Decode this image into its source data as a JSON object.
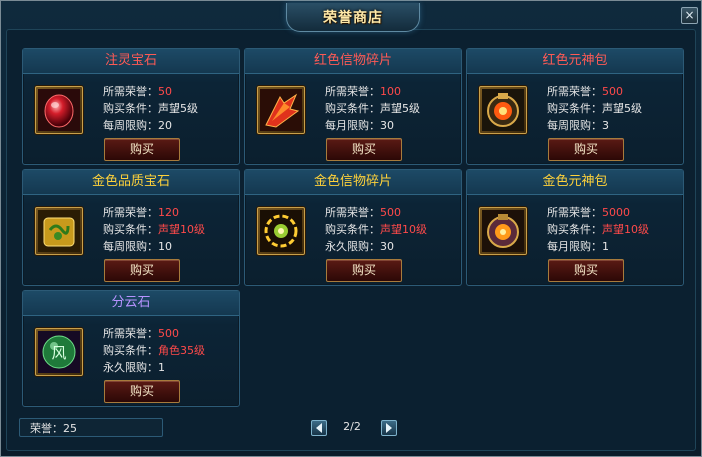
{
  "window": {
    "title": "荣誉商店",
    "close_label": "×"
  },
  "labels": {
    "cost": "所需荣誉：",
    "condition": "购买条件：",
    "buy": "购买"
  },
  "items": [
    {
      "name": "注灵宝石",
      "name_color": "red",
      "cost": "50",
      "condition": "声望5级",
      "limit_label": "每周限购：",
      "limit": "20",
      "icon": "red-gem-icon"
    },
    {
      "name": "红色信物碎片",
      "name_color": "red",
      "cost": "100",
      "condition": "声望5级",
      "limit_label": "每月限购：",
      "limit": "30",
      "icon": "red-feather-fragment-icon"
    },
    {
      "name": "红色元神包",
      "name_color": "red",
      "cost": "500",
      "condition": "声望5级",
      "limit_label": "每周限购：",
      "limit": "3",
      "icon": "red-spirit-pack-icon"
    },
    {
      "name": "金色品质宝石",
      "name_color": "gold",
      "cost": "120",
      "condition": "声望10级",
      "limit_label": "每周限购：",
      "limit": "10",
      "icon": "gold-dragon-gem-icon"
    },
    {
      "name": "金色信物碎片",
      "name_color": "gold",
      "cost": "500",
      "condition": "声望10级",
      "limit_label": "永久限购：",
      "limit": "30",
      "icon": "gold-fragment-icon"
    },
    {
      "name": "金色元神包",
      "name_color": "gold",
      "cost": "5000",
      "condition": "声望10级",
      "limit_label": "每月限购：",
      "limit": "1",
      "icon": "gold-spirit-pack-icon"
    },
    {
      "name": "分云石",
      "name_color": "purple",
      "cost": "500",
      "condition": "角色35级",
      "limit_label": "永久限购：",
      "limit": "1",
      "icon": "wind-stone-icon"
    }
  ],
  "footer": {
    "honor_label": "荣誉：",
    "honor_value": "25",
    "page": "2/2"
  },
  "colors": {
    "red_text": "#ff4a4a",
    "gold_text": "#ffd23a",
    "purple_text": "#b693ff",
    "panel_bg": "#0b2030"
  }
}
